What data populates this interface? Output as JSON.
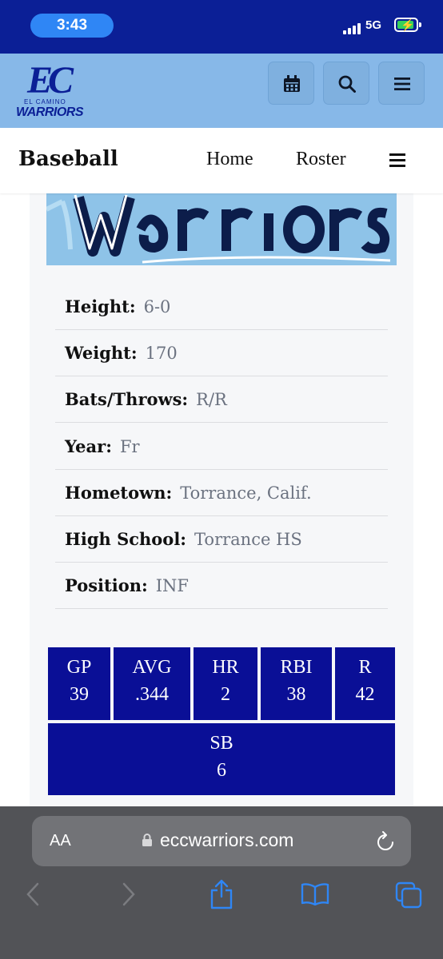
{
  "status_bar": {
    "time": "3:43",
    "network": "5G"
  },
  "header": {
    "logo_mark": "EC",
    "logo_small": "EL CAMINO",
    "logo_name": "WARRIORS",
    "icons": [
      "calendar-icon",
      "search-icon",
      "menu-icon"
    ]
  },
  "sub_nav": {
    "title": "Baseball",
    "links": [
      "Home",
      "Roster"
    ]
  },
  "bio": [
    {
      "label": "Height:",
      "value": "6-0"
    },
    {
      "label": "Weight:",
      "value": "170"
    },
    {
      "label": "Bats/Throws:",
      "value": "R/R"
    },
    {
      "label": "Year:",
      "value": "Fr"
    },
    {
      "label": "Hometown:",
      "value": "Torrance, Calif."
    },
    {
      "label": "High School:",
      "value": "Torrance HS"
    },
    {
      "label": "Position:",
      "value": "INF"
    }
  ],
  "stats": [
    {
      "label": "GP",
      "value": "39"
    },
    {
      "label": "AVG",
      "value": ".344"
    },
    {
      "label": "HR",
      "value": "2"
    },
    {
      "label": "RBI",
      "value": "38"
    },
    {
      "label": "R",
      "value": "42"
    },
    {
      "label": "SB",
      "value": "6"
    }
  ],
  "browser": {
    "aa_label": "AA",
    "url": "eccwarriors.com"
  },
  "colors": {
    "navy": "#0b1f96",
    "stat_bg": "#0a0f96",
    "header_light_blue": "#87b8e8",
    "browser_gray": "#525357",
    "toolbar_blue": "#2f86f5"
  }
}
